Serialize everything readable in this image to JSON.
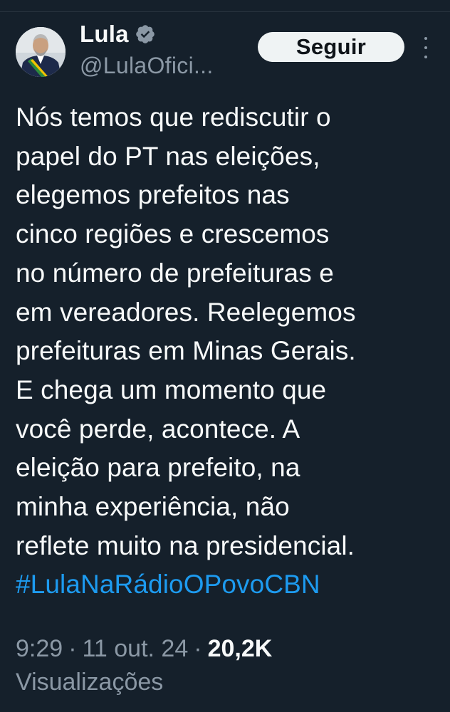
{
  "author": {
    "display_name": "Lula",
    "handle": "@LulaOfici...",
    "avatar_icon": "person-avatar-photo",
    "verified_icon": "verified-badge-icon"
  },
  "actions": {
    "follow_label": "Seguir",
    "more_icon": "more-options-icon"
  },
  "tweet": {
    "lines": [
      "Nós temos que rediscutir o",
      "papel do PT nas eleições,",
      "elegemos prefeitos nas",
      "cinco regiões e crescemos",
      "no número de prefeituras e",
      "em vereadores. Reelegemos",
      "prefeituras em Minas Gerais.",
      "E chega um momento que",
      "você perde, acontece. A",
      "eleição para prefeito, na",
      "minha experiência, não",
      "reflete muito na presidencial."
    ],
    "hashtag": "#LulaNaRádioOPovoCBN"
  },
  "meta": {
    "time": "9:29",
    "separator": "·",
    "date": "11 out. 24",
    "views_count": "20,2K",
    "views_label": "Visualizações"
  },
  "colors": {
    "background": "#15202b",
    "text_primary": "#f7f9f9",
    "text_secondary": "#8b98a5",
    "link": "#1d9bf0",
    "button_bg": "#eff3f4"
  }
}
